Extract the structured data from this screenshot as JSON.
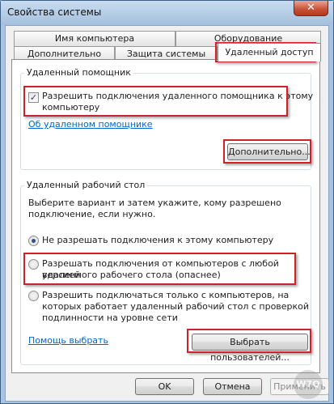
{
  "window": {
    "title": "Свойства системы",
    "close_glyph": "✕"
  },
  "tabs": {
    "row1": [
      {
        "label": "Имя компьютера"
      },
      {
        "label": "Оборудование"
      }
    ],
    "row2": [
      {
        "label": "Дополнительно"
      },
      {
        "label": "Защита системы"
      },
      {
        "label": "Удаленный доступ",
        "active": true
      }
    ]
  },
  "remote_assistance": {
    "group_label": "Удаленный помощник",
    "allow_checkbox": {
      "label_line1": "Разрешить подключения удаленного помощника к этому",
      "label_line2": "компьютеру",
      "checked": true,
      "check_glyph": "✓"
    },
    "about_link": "Об удаленном помощнике",
    "advanced_button": "Дополнительно..."
  },
  "remote_desktop": {
    "group_label": "Удаленный рабочий стол",
    "instruction_line1": "Выберите вариант и затем укажите, кому разрешено",
    "instruction_line2": "подключение, если нужно.",
    "options": [
      {
        "lines": [
          "Не разрешать подключения к этому компьютеру"
        ],
        "selected": true
      },
      {
        "lines": [
          "Разрешать подключения от компьютеров с любой версией",
          "удаленного рабочего стола (опаснее)"
        ],
        "selected": false
      },
      {
        "lines": [
          "Разрешить подключаться только с компьютеров, на",
          "которых работает удаленный рабочий стол с проверкой",
          "подлинности на уровне сети"
        ],
        "selected": false
      }
    ],
    "help_link": "Помощь выбрать",
    "select_users_button": "Выбрать пользователей..."
  },
  "footer": {
    "ok_button": "OK",
    "cancel_button": "Отмена",
    "apply_button": "Применить"
  },
  "watermark": "W7Q",
  "colors": {
    "highlight": "#d0202a",
    "link": "#0066cc",
    "title_bar": "#a4c0de"
  }
}
